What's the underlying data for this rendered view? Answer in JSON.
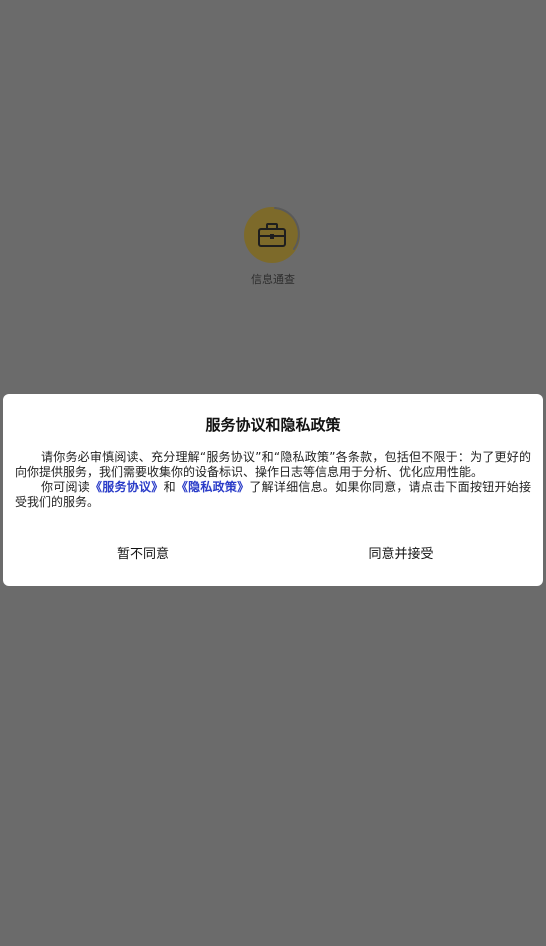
{
  "app": {
    "name": "信息通查",
    "icon": "briefcase-icon",
    "icon_bg_color": "#7d6a2a",
    "overlay_color": "#6b6b6b"
  },
  "dialog": {
    "title": "服务协议和隐私政策",
    "paragraph1": "请你务必审慎阅读、充分理解“服务协议”和“隐私政策”各条款，包括但不限于：为了更好的向你提供服务，我们需要收集你的设备标识、操作日志等信息用于分析、优化应用性能。",
    "paragraph2_prefix": "你可阅读",
    "service_link": "《服务协议》",
    "paragraph2_and": "和",
    "privacy_link": "《隐私政策》",
    "paragraph2_suffix": "了解详细信息。如果你同意，请点击下面按钮开始接受我们的服务。",
    "link_color": "#2a3cc8",
    "disagree_label": "暂不同意",
    "agree_label": "同意并接受"
  }
}
